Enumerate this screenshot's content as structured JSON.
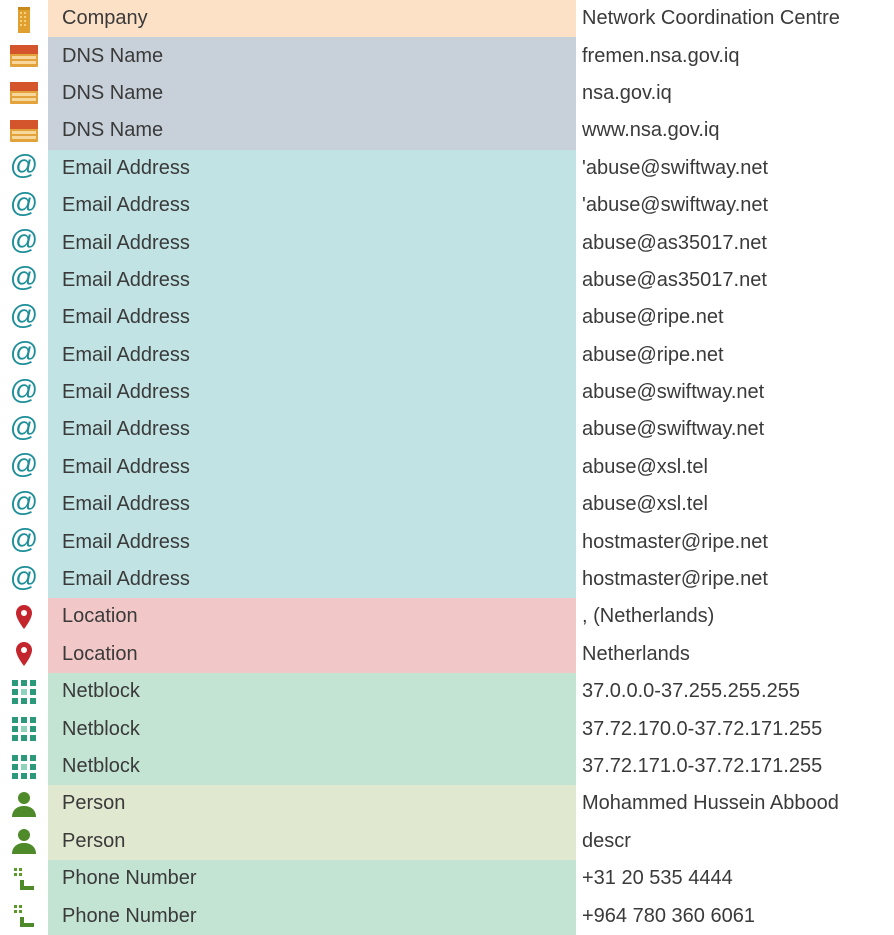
{
  "colors": {
    "Company": "#fde1c7",
    "DNS Name": "#c8d1da",
    "Email Address": "#c1e3e4",
    "Location": "#f2c7c7",
    "Netblock": "#c3e3d3",
    "Person": "#e1e8d0",
    "Phone Number": "#c3e3d3"
  },
  "icons": {
    "Company": "building-icon",
    "DNS Name": "dns-icon",
    "Email Address": "at-icon",
    "Location": "location-pin-icon",
    "Netblock": "netblock-icon",
    "Person": "person-icon",
    "Phone Number": "phone-icon"
  },
  "at_symbol": "@",
  "rows": [
    {
      "type": "Company",
      "value": "Network Coordination Centre"
    },
    {
      "type": "DNS Name",
      "value": "fremen.nsa.gov.iq"
    },
    {
      "type": "DNS Name",
      "value": "nsa.gov.iq"
    },
    {
      "type": "DNS Name",
      "value": "www.nsa.gov.iq"
    },
    {
      "type": "Email Address",
      "value": "'abuse@swiftway.net"
    },
    {
      "type": "Email Address",
      "value": "'abuse@swiftway.net"
    },
    {
      "type": "Email Address",
      "value": "abuse@as35017.net"
    },
    {
      "type": "Email Address",
      "value": "abuse@as35017.net"
    },
    {
      "type": "Email Address",
      "value": "abuse@ripe.net"
    },
    {
      "type": "Email Address",
      "value": "abuse@ripe.net"
    },
    {
      "type": "Email Address",
      "value": "abuse@swiftway.net"
    },
    {
      "type": "Email Address",
      "value": "abuse@swiftway.net"
    },
    {
      "type": "Email Address",
      "value": "abuse@xsl.tel"
    },
    {
      "type": "Email Address",
      "value": "abuse@xsl.tel"
    },
    {
      "type": "Email Address",
      "value": "hostmaster@ripe.net"
    },
    {
      "type": "Email Address",
      "value": "hostmaster@ripe.net"
    },
    {
      "type": "Location",
      "value": ",  (Netherlands)"
    },
    {
      "type": "Location",
      "value": "Netherlands"
    },
    {
      "type": "Netblock",
      "value": "37.0.0.0-37.255.255.255"
    },
    {
      "type": "Netblock",
      "value": "37.72.170.0-37.72.171.255"
    },
    {
      "type": "Netblock",
      "value": "37.72.171.0-37.72.171.255"
    },
    {
      "type": "Person",
      "value": "Mohammed Hussein Abbood"
    },
    {
      "type": "Person",
      "value": "descr"
    },
    {
      "type": "Phone Number",
      "value": "+31 20 535 4444"
    },
    {
      "type": "Phone Number",
      "value": "+964 780 360 6061"
    }
  ]
}
